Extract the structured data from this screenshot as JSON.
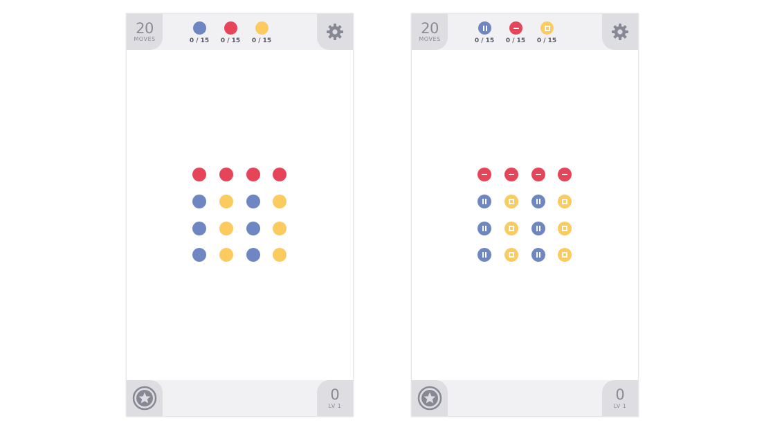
{
  "colors": {
    "blue": "#6e86c1",
    "red": "#e54459",
    "yellow": "#fbcb60",
    "bar": "#f1f1f3",
    "corner": "#dedee2"
  },
  "screens": [
    {
      "id": "left",
      "mode": "color",
      "moves": {
        "value": "20",
        "label": "MOVES"
      },
      "goals": [
        {
          "color": "blue",
          "count": "0 / 15"
        },
        {
          "color": "red",
          "count": "0 / 15"
        },
        {
          "color": "yellow",
          "count": "0 / 15"
        }
      ],
      "score": {
        "value": "0",
        "label": "LV 1"
      },
      "settings_icon": "gear-icon",
      "achievements_icon": "star-icon",
      "board": [
        [
          "red",
          "red",
          "red",
          "red"
        ],
        [
          "blue",
          "yellow",
          "blue",
          "yellow"
        ],
        [
          "blue",
          "yellow",
          "blue",
          "yellow"
        ],
        [
          "blue",
          "yellow",
          "blue",
          "yellow"
        ]
      ]
    },
    {
      "id": "right",
      "mode": "colorblind",
      "moves": {
        "value": "20",
        "label": "MOVES"
      },
      "goals": [
        {
          "color": "blue",
          "count": "0 / 15"
        },
        {
          "color": "red",
          "count": "0 / 15"
        },
        {
          "color": "yellow",
          "count": "0 / 15"
        }
      ],
      "score": {
        "value": "0",
        "label": "LV 1"
      },
      "settings_icon": "gear-icon",
      "achievements_icon": "star-icon",
      "board": [
        [
          "red",
          "red",
          "red",
          "red"
        ],
        [
          "blue",
          "yellow",
          "blue",
          "yellow"
        ],
        [
          "blue",
          "yellow",
          "blue",
          "yellow"
        ],
        [
          "blue",
          "yellow",
          "blue",
          "yellow"
        ]
      ]
    }
  ]
}
